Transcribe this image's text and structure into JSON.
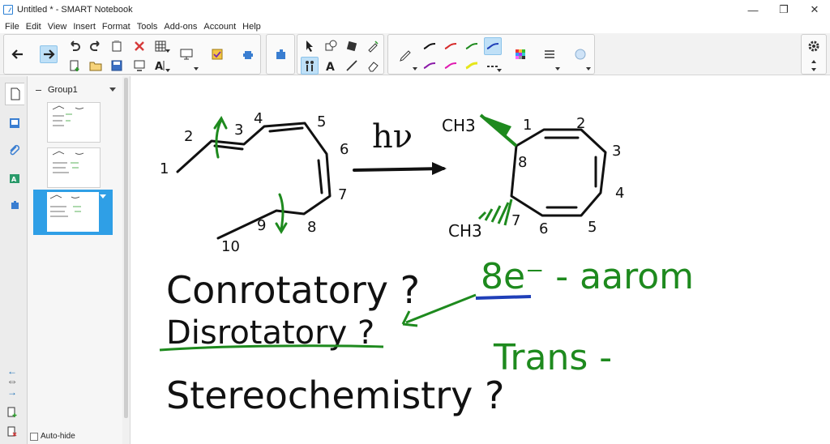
{
  "window": {
    "title": "Untitled * - SMART Notebook",
    "minimize": "—",
    "maximize": "❐",
    "close": "✕"
  },
  "menu": [
    "File",
    "Edit",
    "View",
    "Insert",
    "Format",
    "Tools",
    "Add-ons",
    "Account",
    "Help"
  ],
  "sidebar": {
    "group_label": "Group1",
    "auto_hide_label": "Auto-hide"
  },
  "canvas": {
    "left_molecule_numbers": [
      "1",
      "2",
      "3",
      "4",
      "5",
      "6",
      "7",
      "8",
      "9",
      "10"
    ],
    "arrow_label": "hν",
    "right_molecule": {
      "substituent_top": "CH3",
      "substituent_bottom": "CH3",
      "numbers": [
        "1",
        "2",
        "3",
        "4",
        "5",
        "6",
        "7",
        "8"
      ]
    },
    "question_1": "Conrotatory ?",
    "question_2": "Disrotatory ?",
    "question_3": "Stereochemistry ?",
    "note_electrons": "8e⁻ - aarom",
    "note_trans": "Trans -"
  },
  "colors": {
    "ink_black": "#111111",
    "ink_green": "#1e8a1e",
    "ink_blue": "#1f3fb8",
    "selection_blue": "#2f9fe6"
  }
}
